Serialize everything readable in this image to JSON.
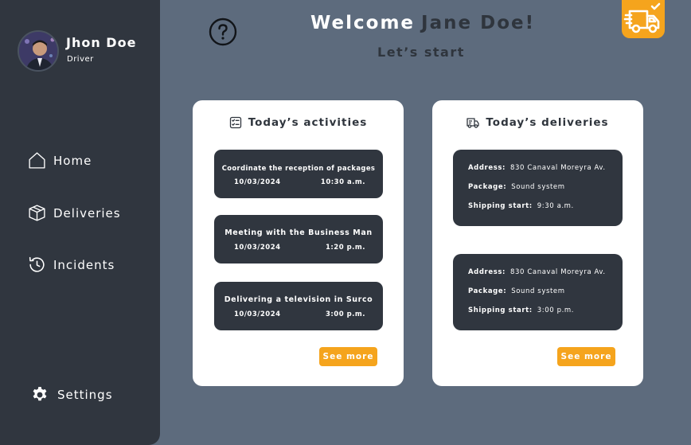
{
  "user": {
    "name": "Jhon Doe",
    "role": "Driver"
  },
  "nav": {
    "home": "Home",
    "deliveries": "Deliveries",
    "incidents": "Incidents",
    "settings": "Settings"
  },
  "header": {
    "welcome": "Welcome",
    "user_name": "Jane Doe!",
    "subtitle": "Let’s start"
  },
  "activities": {
    "title": "Today’s activities",
    "items": [
      {
        "title": "Coordinate the reception of packages",
        "date": "10/03/2024",
        "time": "10:30 a.m."
      },
      {
        "title": "Meeting with the Business Man",
        "date": "10/03/2024",
        "time": "1:20 p.m."
      },
      {
        "title": "Delivering a television in Surco",
        "date": "10/03/2024",
        "time": "3:00 p.m."
      }
    ],
    "see_more": "See more"
  },
  "deliveries": {
    "title": "Today’s deliveries",
    "labels": {
      "address": "Address:",
      "package": "Package:",
      "shipping": "Shipping start:"
    },
    "items": [
      {
        "address": "830 Canaval Moreyra Av.",
        "package": "Sound system",
        "shipping_start": "9:30 a.m."
      },
      {
        "address": "830 Canaval Moreyra Av.",
        "package": "Sound system",
        "shipping_start": "3:00 p.m."
      }
    ],
    "see_more": "See more"
  },
  "colors": {
    "background": "#5d6b7d",
    "sidebar": "#30363f",
    "accent": "#f5a41d",
    "card": "#ffffff"
  },
  "icons": {
    "help": "question-circle-icon",
    "truck_badge": "fast-delivery-truck-icon",
    "home": "home-icon",
    "deliveries": "package-box-icon",
    "incidents": "history-icon",
    "settings": "gear-icon",
    "activities": "checklist-icon",
    "deliveries_title": "truck-icon"
  }
}
